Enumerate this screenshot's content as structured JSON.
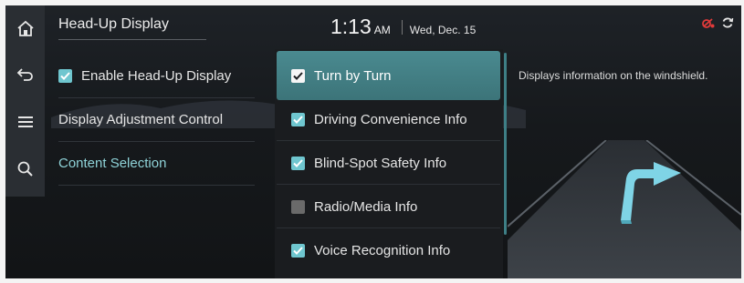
{
  "header": {
    "title": "Head-Up Display",
    "time": "1:13",
    "ampm": "AM",
    "date": "Wed, Dec. 15"
  },
  "rail": {
    "icons": [
      "home-icon",
      "back-icon",
      "menu-icon",
      "search-icon"
    ]
  },
  "status_icons": [
    "no-signal-icon",
    "sync-icon"
  ],
  "left_menu": {
    "enable_label": "Enable Head-Up Display",
    "enable_checked": true,
    "items": [
      "Display Adjustment Control",
      "Content Selection"
    ],
    "active_item": "Content Selection"
  },
  "content_options": [
    {
      "label": "Turn by Turn",
      "checked": true,
      "selected": true
    },
    {
      "label": "Driving Convenience Info",
      "checked": true,
      "selected": false
    },
    {
      "label": "Blind-Spot Safety Info",
      "checked": true,
      "selected": false
    },
    {
      "label": "Radio/Media Info",
      "checked": false,
      "selected": false
    },
    {
      "label": "Voice Recognition Info",
      "checked": true,
      "selected": false
    }
  ],
  "description": "Displays information on the windshield.",
  "colors": {
    "accent": "#6fc6cf",
    "selected_row": "#4a8a90",
    "active_text": "#8fd3d8",
    "warning": "#e03a3a",
    "arrow": "#7fd4e6"
  }
}
